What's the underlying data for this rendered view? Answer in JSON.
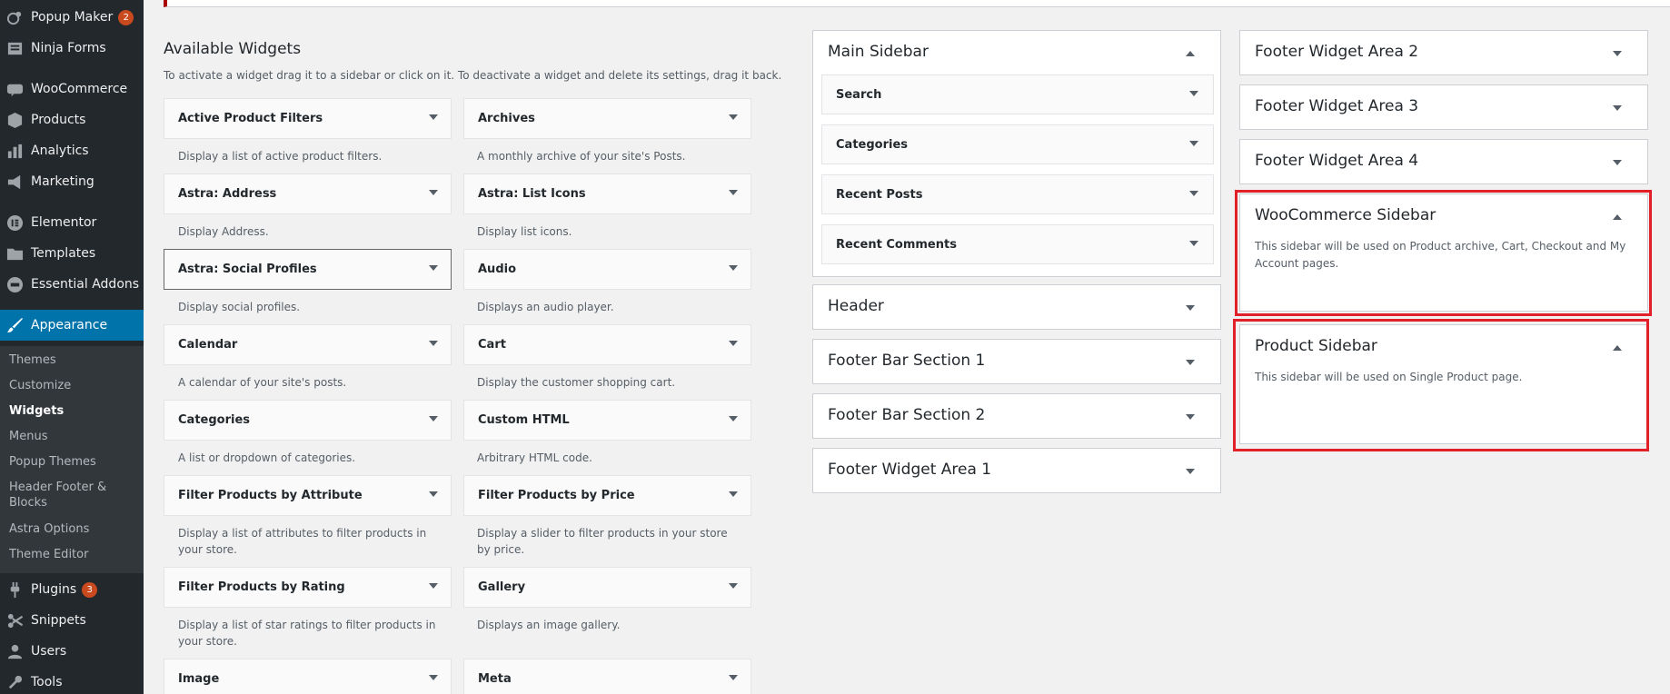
{
  "admin_menu": {
    "items": [
      {
        "label": "Popup Maker",
        "icon": "popup-icon",
        "count": "2"
      },
      {
        "label": "Ninja Forms",
        "icon": "forms-icon"
      },
      {
        "label": "WooCommerce",
        "icon": "woo-icon"
      },
      {
        "label": "Products",
        "icon": "box-icon"
      },
      {
        "label": "Analytics",
        "icon": "bar-chart-icon"
      },
      {
        "label": "Marketing",
        "icon": "megaphone-icon"
      },
      {
        "label": "Elementor",
        "icon": "elementor-icon"
      },
      {
        "label": "Templates",
        "icon": "folder-icon"
      },
      {
        "label": "Essential Addons",
        "icon": "ea-icon"
      },
      {
        "label": "Appearance",
        "icon": "paintbrush-icon"
      },
      {
        "label": "Plugins",
        "icon": "plug-icon",
        "count": "3"
      },
      {
        "label": "Snippets",
        "icon": "scissors-icon"
      },
      {
        "label": "Users",
        "icon": "user-icon"
      },
      {
        "label": "Tools",
        "icon": "wrench-icon"
      }
    ],
    "submenu": [
      "Themes",
      "Customize",
      "Widgets",
      "Menus",
      "Popup Themes",
      "Header Footer & Blocks",
      "Astra Options",
      "Theme Editor"
    ],
    "accent": "#0073aa"
  },
  "available": {
    "title": "Available Widgets",
    "description": "To activate a widget drag it to a sidebar or click on it. To deactivate a widget and delete its settings, drag it back.",
    "widgets": [
      {
        "name": "Active Product Filters",
        "desc": "Display a list of active product filters."
      },
      {
        "name": "Archives",
        "desc": "A monthly archive of your site's Posts."
      },
      {
        "name": "Astra: Address",
        "desc": "Display Address."
      },
      {
        "name": "Astra: List Icons",
        "desc": "Display list icons."
      },
      {
        "name": "Astra: Social Profiles",
        "desc": "Display social profiles."
      },
      {
        "name": "Audio",
        "desc": "Displays an audio player."
      },
      {
        "name": "Calendar",
        "desc": "A calendar of your site's posts."
      },
      {
        "name": "Cart",
        "desc": "Display the customer shopping cart."
      },
      {
        "name": "Categories",
        "desc": "A list or dropdown of categories."
      },
      {
        "name": "Custom HTML",
        "desc": "Arbitrary HTML code."
      },
      {
        "name": "Filter Products by Attribute",
        "desc": "Display a list of attributes to filter products in your store."
      },
      {
        "name": "Filter Products by Price",
        "desc": "Display a slider to filter products in your store by price."
      },
      {
        "name": "Filter Products by Rating",
        "desc": "Display a list of star ratings to filter products in your store."
      },
      {
        "name": "Gallery",
        "desc": "Displays an image gallery."
      },
      {
        "name": "Image",
        "desc": ""
      },
      {
        "name": "Meta",
        "desc": ""
      }
    ]
  },
  "sidebars": {
    "main": {
      "title": "Main Sidebar",
      "widgets": [
        "Search",
        "Categories",
        "Recent Posts",
        "Recent Comments"
      ]
    },
    "col2": [
      "Header",
      "Footer Bar Section 1",
      "Footer Bar Section 2",
      "Footer Widget Area 1"
    ],
    "col3": [
      "Footer Widget Area 2",
      "Footer Widget Area 3",
      "Footer Widget Area 4"
    ],
    "woocommerce": {
      "title": "WooCommerce Sidebar",
      "desc": "This sidebar will be used on Product archive, Cart, Checkout and My Account pages."
    },
    "product": {
      "title": "Product Sidebar",
      "desc": "This sidebar will be used on Single Product page."
    },
    "highlight_color": "#e2202a"
  }
}
